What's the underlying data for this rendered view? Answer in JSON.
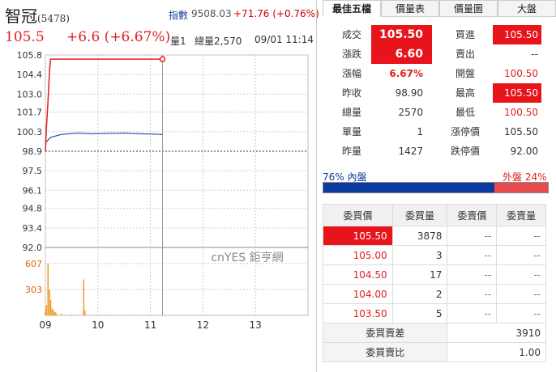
{
  "header": {
    "name": "智冠",
    "code": "(5478)",
    "index_label": "指數",
    "index_value": "9508.03",
    "index_change": "+71.76 (+0.76%)",
    "price": "105.5",
    "change": "+6.6 (+6.67%)",
    "volume_label": "量1",
    "total_label": "總量2,570",
    "datetime": "09/01 11:14"
  },
  "chart": {
    "y_ticks": [
      "105.8",
      "104.4",
      "103.0",
      "101.7",
      "100.3",
      "98.9",
      "97.5",
      "96.1",
      "94.8",
      "93.4",
      "92.0"
    ],
    "vol_ticks": [
      "607",
      "303"
    ],
    "x_ticks": [
      "09",
      "10",
      "11",
      "12",
      "13"
    ],
    "watermark": "cnYES 鉅亨網"
  },
  "chart_data": {
    "type": "line",
    "series": [
      {
        "values": [
          [
            9.0,
            98.9
          ],
          [
            9.02,
            100.6
          ],
          [
            9.05,
            102.5
          ],
          [
            9.08,
            104.8
          ],
          [
            9.1,
            105.5
          ],
          [
            11.23,
            105.5
          ]
        ]
      },
      {
        "values": [
          [
            9.0,
            99.5
          ],
          [
            9.1,
            99.9
          ],
          [
            9.3,
            100.1
          ],
          [
            9.6,
            100.2
          ],
          [
            9.9,
            100.15
          ],
          [
            10.2,
            100.18
          ],
          [
            10.5,
            100.2
          ],
          [
            10.8,
            100.15
          ],
          [
            11.1,
            100.12
          ],
          [
            11.23,
            100.1
          ]
        ]
      }
    ],
    "reference": 98.9,
    "ylim": [
      92.0,
      105.8
    ],
    "xlim": [
      9,
      14
    ],
    "volume_ylim": [
      0,
      700
    ],
    "volume": [
      [
        9.0,
        40
      ],
      [
        9.02,
        120
      ],
      [
        9.05,
        607
      ],
      [
        9.08,
        300
      ],
      [
        9.1,
        180
      ],
      [
        9.13,
        80
      ],
      [
        9.15,
        60
      ],
      [
        9.18,
        40
      ],
      [
        9.2,
        30
      ],
      [
        9.3,
        20
      ],
      [
        9.5,
        10
      ],
      [
        9.73,
        420
      ],
      [
        9.75,
        60
      ],
      [
        10.2,
        8
      ],
      [
        10.6,
        6
      ],
      [
        11.0,
        4
      ]
    ]
  },
  "tabs": [
    "最佳五檔",
    "價量表",
    "價量圖",
    "大盤"
  ],
  "quote": {
    "left": [
      {
        "label": "成交",
        "value": "105.50",
        "style": "redbox"
      },
      {
        "label": "漲跌",
        "value": "6.60",
        "style": "redbox"
      },
      {
        "label": "漲幅",
        "value": "6.67%",
        "style": "redbold"
      },
      {
        "label": "昨收",
        "value": "98.90",
        "style": ""
      },
      {
        "label": "總量",
        "value": "2570",
        "style": ""
      },
      {
        "label": "單量",
        "value": "1",
        "style": ""
      },
      {
        "label": "昨量",
        "value": "1427",
        "style": ""
      }
    ],
    "right": [
      {
        "label": "買進",
        "value": "105.50",
        "style": "redbox2"
      },
      {
        "label": "賣出",
        "value": "--",
        "style": ""
      },
      {
        "label": "開盤",
        "value": "100.50",
        "style": "red"
      },
      {
        "label": "最高",
        "value": "105.50",
        "style": "redbox2"
      },
      {
        "label": "最低",
        "value": "100.50",
        "style": "red"
      },
      {
        "label": "漲停價",
        "value": "105.50",
        "style": ""
      },
      {
        "label": "跌停價",
        "value": "92.00",
        "style": ""
      }
    ]
  },
  "ratio": {
    "inner": "76% 內盤",
    "outer": "外盤 24%",
    "inner_pct": 76,
    "outer_pct": 24
  },
  "book": {
    "headers": [
      "委買價",
      "委買量",
      "委賣價",
      "委賣量"
    ],
    "rows": [
      [
        "105.50",
        "3878",
        "--",
        "--"
      ],
      [
        "105.00",
        "3",
        "--",
        "--"
      ],
      [
        "104.50",
        "17",
        "--",
        "--"
      ],
      [
        "104.00",
        "2",
        "--",
        "--"
      ],
      [
        "103.50",
        "5",
        "--",
        "--"
      ]
    ],
    "diff_label": "委買賣差",
    "diff_value": "3910",
    "ratio_label": "委買賣比",
    "ratio_value": "1.00"
  },
  "colors": {
    "up": "#e02020",
    "line_blue": "#2a4aa8",
    "vol": "#f0a030",
    "inner": "#0b3a9e",
    "outer": "#e84b4b"
  }
}
